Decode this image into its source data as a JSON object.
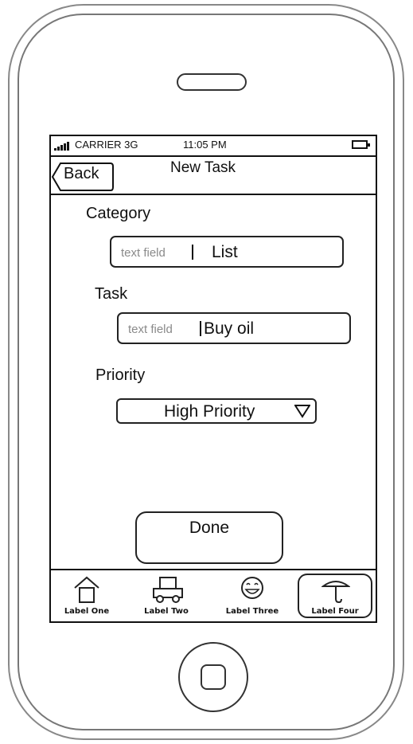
{
  "status_bar": {
    "carrier": "CARRIER 3G",
    "time": "11:05 PM"
  },
  "nav_bar": {
    "back_label": "Back",
    "title": "New Task"
  },
  "form": {
    "category": {
      "label": "Category",
      "placeholder": "text field",
      "value": "List"
    },
    "task": {
      "label": "Task",
      "placeholder": "text field",
      "value": "Buy oil"
    },
    "priority": {
      "label": "Priority",
      "selected": "High Priority"
    }
  },
  "done_label": "Done",
  "tab_bar": {
    "tabs": [
      {
        "label": "Label One",
        "icon": "house-icon"
      },
      {
        "label": "Label Two",
        "icon": "car-icon"
      },
      {
        "label": "Label Three",
        "icon": "smiley-icon"
      },
      {
        "label": "Label Four",
        "icon": "umbrella-icon",
        "selected": true
      }
    ]
  }
}
